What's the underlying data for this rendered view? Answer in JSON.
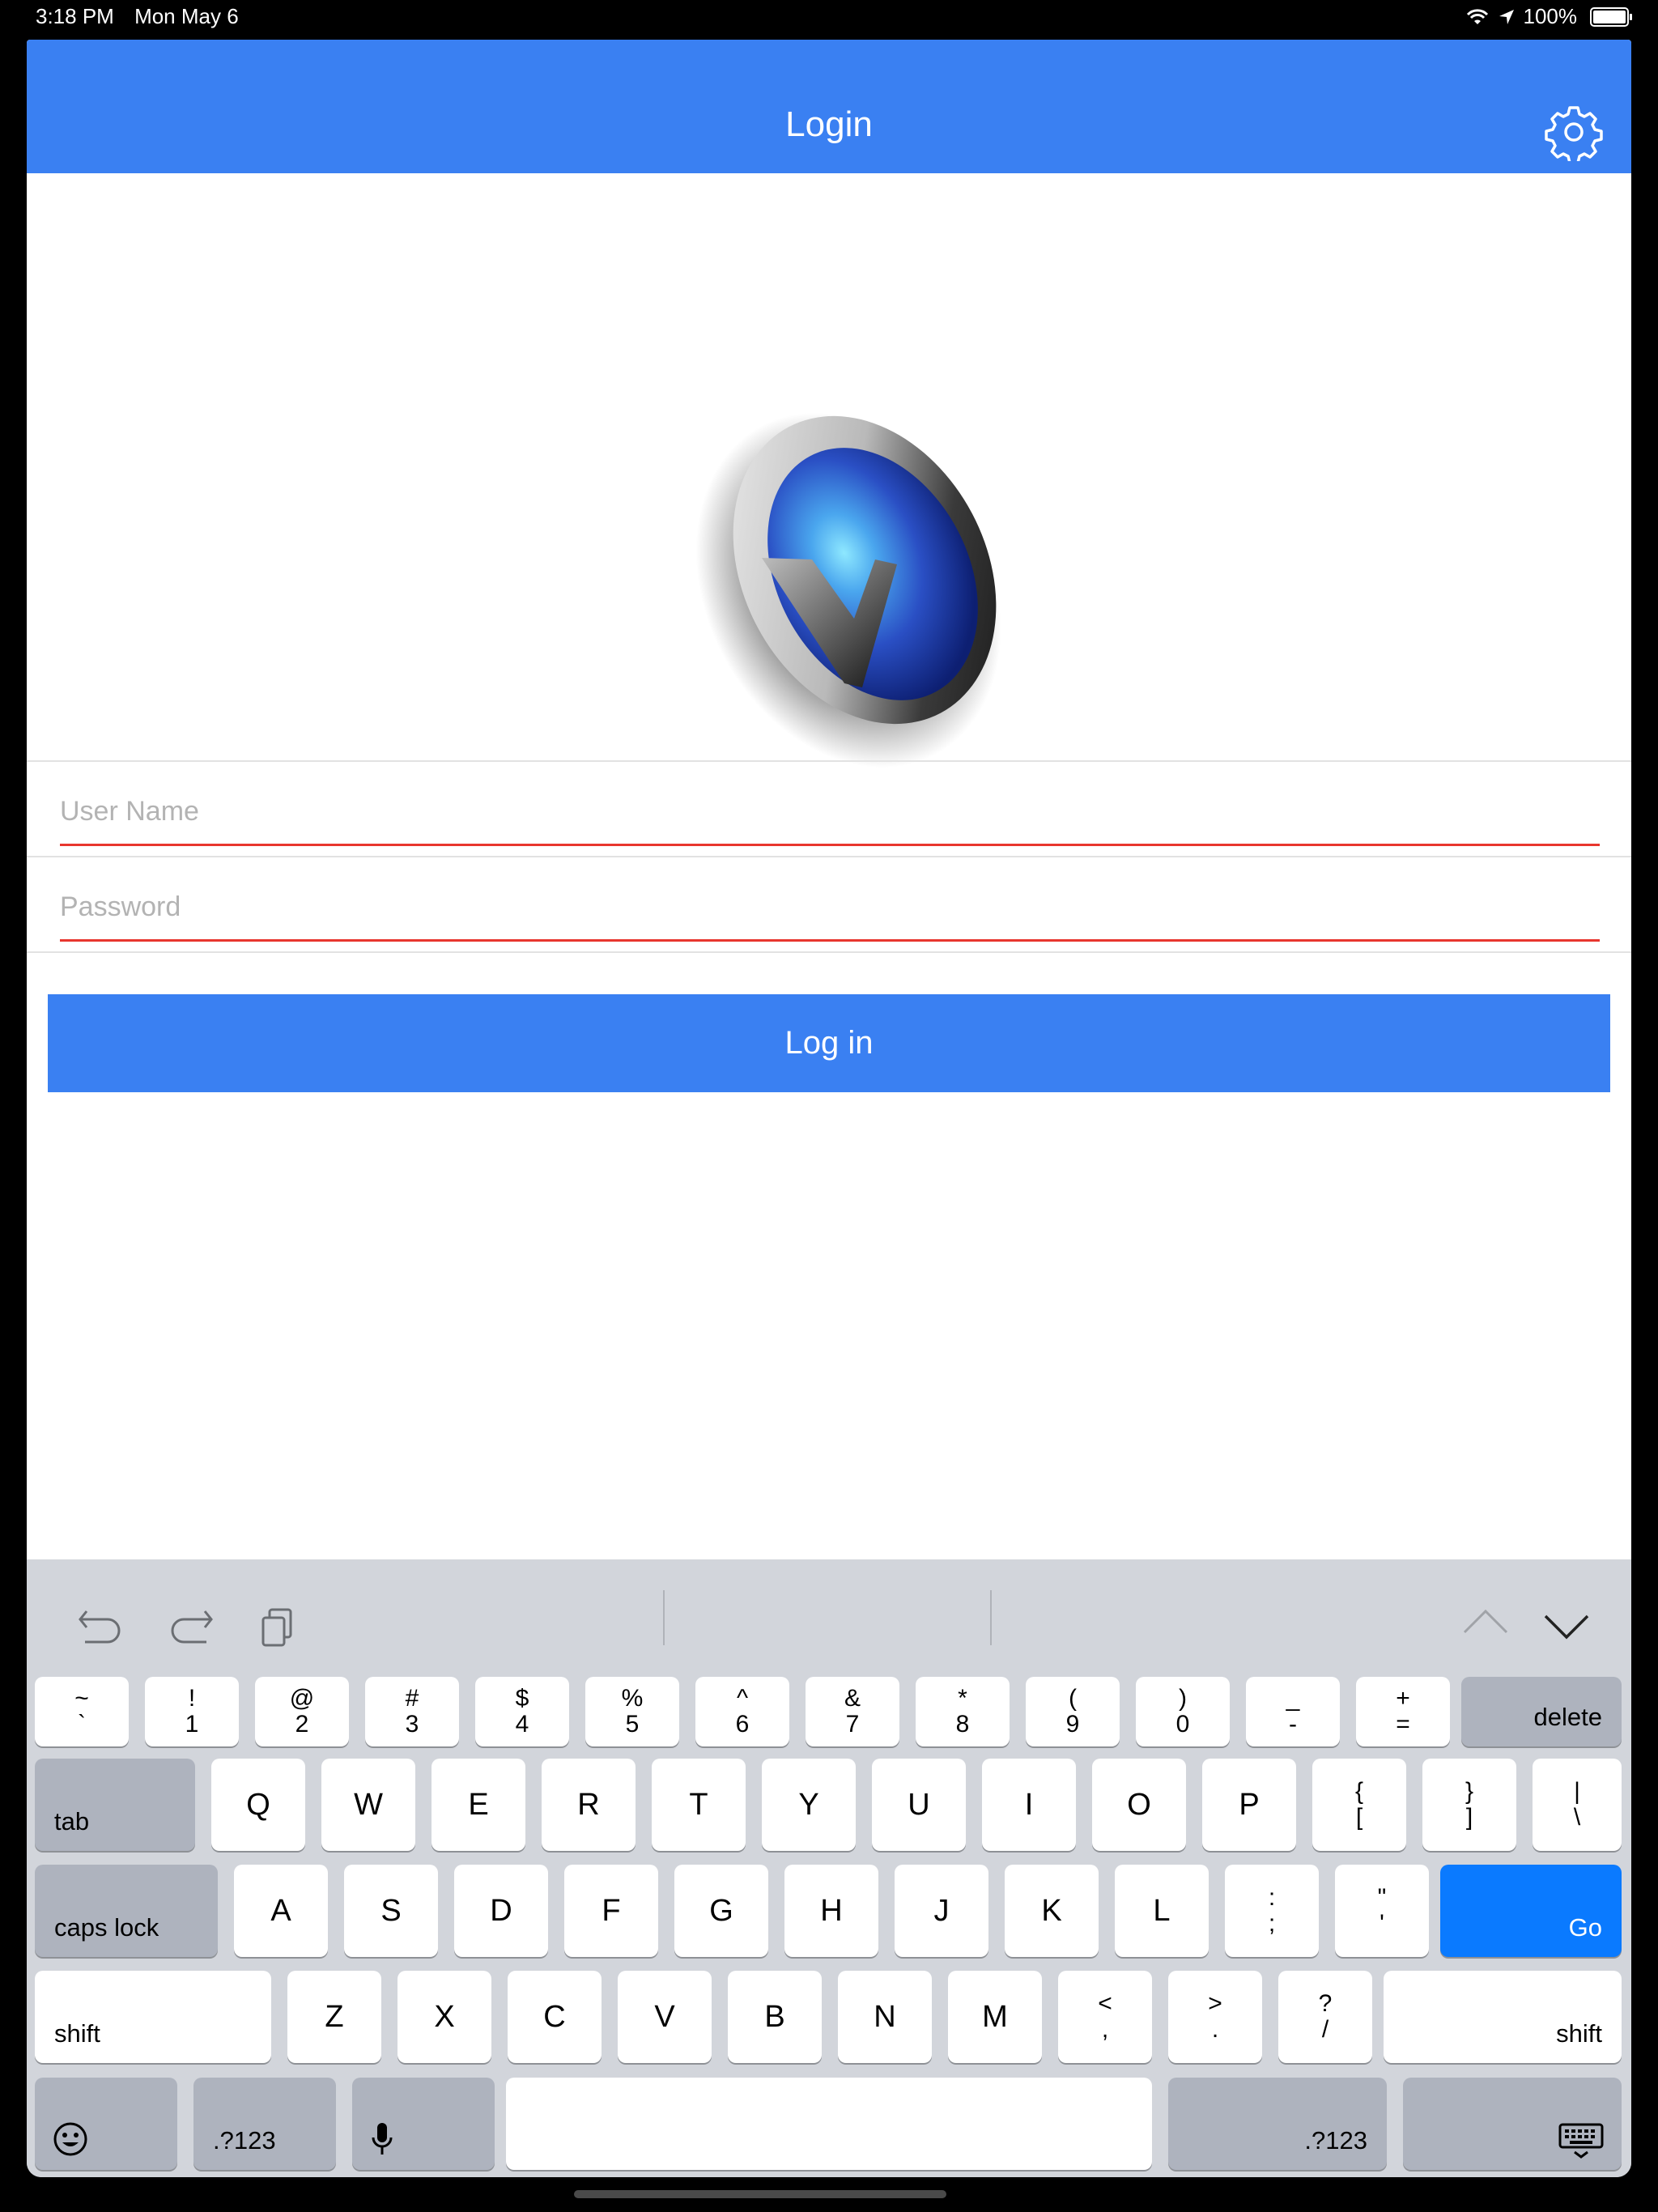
{
  "status_bar": {
    "time": "3:18 PM",
    "date": "Mon May 6",
    "battery": "100%"
  },
  "nav": {
    "title": "Login"
  },
  "form": {
    "username_placeholder": "User Name",
    "password_placeholder": "Password",
    "login_label": "Log in"
  },
  "keyboard": {
    "number_row": [
      {
        "top": "~",
        "bottom": "`"
      },
      {
        "top": "!",
        "bottom": "1"
      },
      {
        "top": "@",
        "bottom": "2"
      },
      {
        "top": "#",
        "bottom": "3"
      },
      {
        "top": "$",
        "bottom": "4"
      },
      {
        "top": "%",
        "bottom": "5"
      },
      {
        "top": "^",
        "bottom": "6"
      },
      {
        "top": "&",
        "bottom": "7"
      },
      {
        "top": "*",
        "bottom": "8"
      },
      {
        "top": "(",
        "bottom": "9"
      },
      {
        "top": ")",
        "bottom": "0"
      },
      {
        "top": "_",
        "bottom": "-"
      },
      {
        "top": "+",
        "bottom": "="
      }
    ],
    "delete_label": "delete",
    "tab_label": "tab",
    "row_q": [
      "Q",
      "W",
      "E",
      "R",
      "T",
      "Y",
      "U",
      "I",
      "O",
      "P"
    ],
    "row_q_symbols": [
      {
        "top": "{",
        "bottom": "["
      },
      {
        "top": "}",
        "bottom": "]"
      },
      {
        "top": "|",
        "bottom": "\\"
      }
    ],
    "caps_label": "caps lock",
    "row_a": [
      "A",
      "S",
      "D",
      "F",
      "G",
      "H",
      "J",
      "K",
      "L"
    ],
    "row_a_symbols": [
      {
        "top": ":",
        "bottom": ";"
      },
      {
        "top": "\"",
        "bottom": "'"
      }
    ],
    "go_label": "Go",
    "shift_label": "shift",
    "row_z": [
      "Z",
      "X",
      "C",
      "V",
      "B",
      "N",
      "M"
    ],
    "row_z_symbols": [
      {
        "top": "<",
        "bottom": ","
      },
      {
        "top": ">",
        "bottom": "."
      },
      {
        "top": "?",
        "bottom": "/"
      }
    ],
    "numeric_label": ".?123",
    "icons": [
      "undo-icon",
      "redo-icon",
      "paste-icon",
      "chevron-up-icon",
      "chevron-down-icon",
      "emoji-icon",
      "microphone-icon",
      "hide-keyboard-icon"
    ]
  },
  "colors": {
    "accent": "#3a80f2",
    "field_underline": "#e8362e",
    "go_key": "#0a7aff"
  }
}
